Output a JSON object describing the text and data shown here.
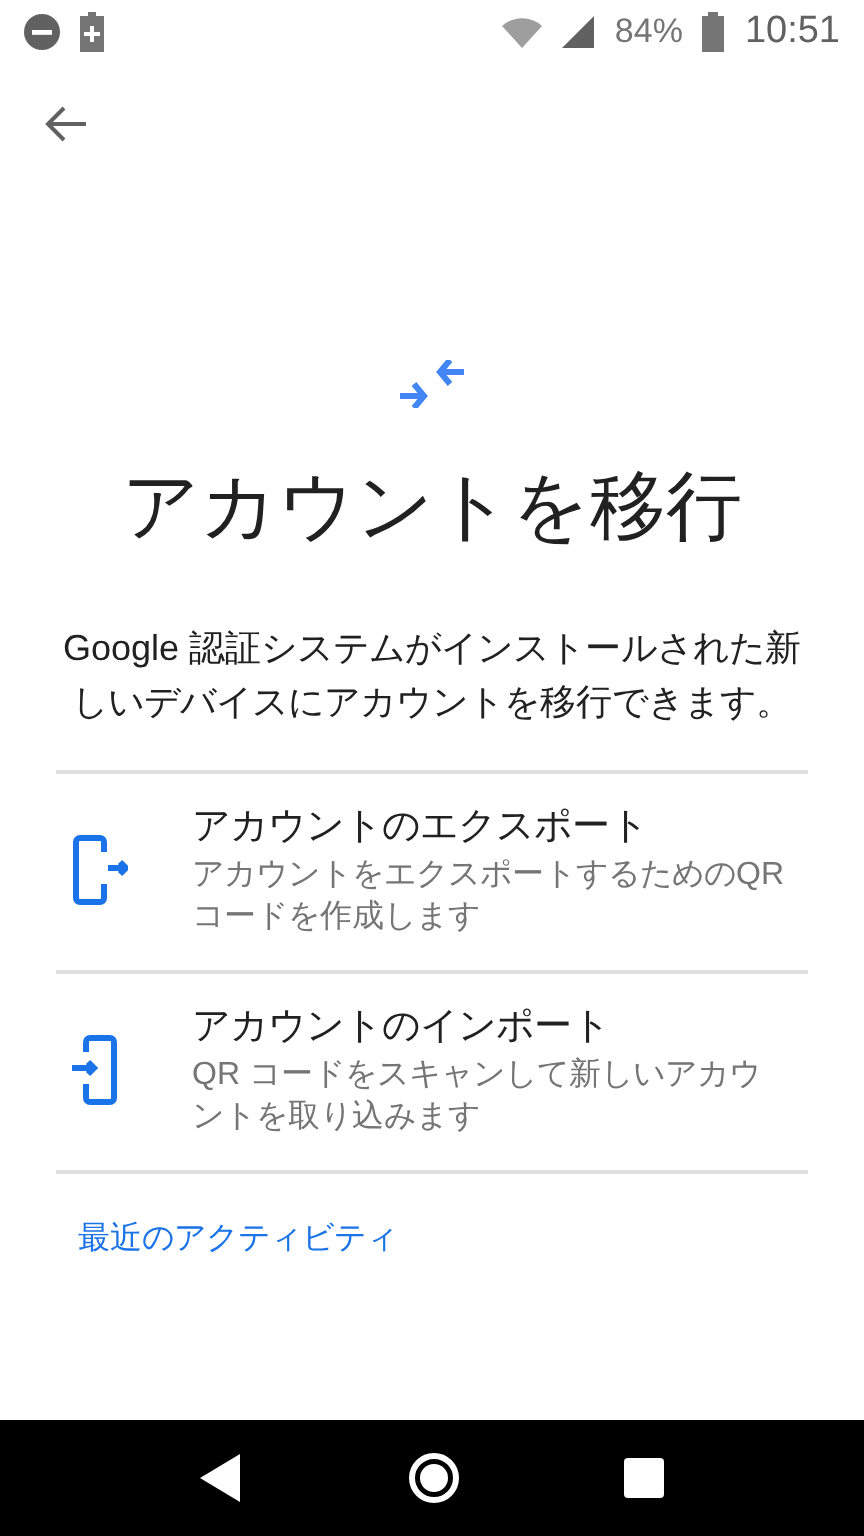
{
  "status_bar": {
    "battery": "84%",
    "time": "10:51"
  },
  "title": "アカウントを移行",
  "description": "Google 認証システムがインストールされた新しいデバイスにアカウントを移行できます。",
  "options": [
    {
      "kind": "export",
      "title": "アカウントのエクスポート",
      "subtitle": "アカウントをエクスポートするためのQR コードを作成します"
    },
    {
      "kind": "import",
      "title": "アカウントのインポート",
      "subtitle": "QR コードをスキャンして新しいアカウントを取り込みます"
    }
  ],
  "link": "最近のアクティビティ"
}
